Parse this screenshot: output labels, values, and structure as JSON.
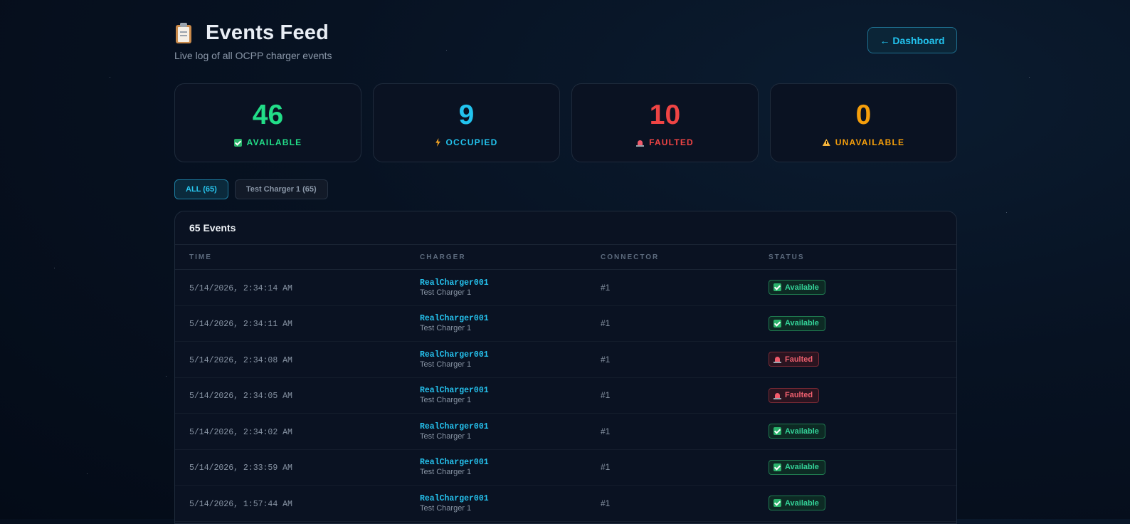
{
  "header": {
    "title": "Events Feed",
    "subtitle": "Live log of all OCPP charger events",
    "title_icon": "clipboard-icon",
    "dashboard_button": "← Dashboard"
  },
  "stats": [
    {
      "value": "46",
      "label": "AVAILABLE",
      "icon": "check-icon",
      "color": "#22dd88"
    },
    {
      "value": "9",
      "label": "OCCUPIED",
      "icon": "bolt-icon",
      "color": "#22c3ee"
    },
    {
      "value": "10",
      "label": "FAULTED",
      "icon": "siren-icon",
      "color": "#ef4444"
    },
    {
      "value": "0",
      "label": "UNAVAILABLE",
      "icon": "warning-icon",
      "color": "#f59e0b"
    }
  ],
  "filters": [
    {
      "label": "ALL (65)",
      "active": true
    },
    {
      "label": "Test Charger 1 (65)",
      "active": false
    }
  ],
  "table": {
    "title": "65 Events",
    "columns": [
      "TIME",
      "CHARGER",
      "CONNECTOR",
      "STATUS"
    ],
    "rows": [
      {
        "time": "5/14/2026, 2:34:14 AM",
        "charger_id": "RealCharger001",
        "charger_name": "Test Charger 1",
        "connector": "#1",
        "status": "Available"
      },
      {
        "time": "5/14/2026, 2:34:11 AM",
        "charger_id": "RealCharger001",
        "charger_name": "Test Charger 1",
        "connector": "#1",
        "status": "Available"
      },
      {
        "time": "5/14/2026, 2:34:08 AM",
        "charger_id": "RealCharger001",
        "charger_name": "Test Charger 1",
        "connector": "#1",
        "status": "Faulted"
      },
      {
        "time": "5/14/2026, 2:34:05 AM",
        "charger_id": "RealCharger001",
        "charger_name": "Test Charger 1",
        "connector": "#1",
        "status": "Faulted"
      },
      {
        "time": "5/14/2026, 2:34:02 AM",
        "charger_id": "RealCharger001",
        "charger_name": "Test Charger 1",
        "connector": "#1",
        "status": "Available"
      },
      {
        "time": "5/14/2026, 2:33:59 AM",
        "charger_id": "RealCharger001",
        "charger_name": "Test Charger 1",
        "connector": "#1",
        "status": "Available"
      },
      {
        "time": "5/14/2026, 1:57:44 AM",
        "charger_id": "RealCharger001",
        "charger_name": "Test Charger 1",
        "connector": "#1",
        "status": "Available"
      }
    ]
  },
  "colors": {
    "accent": "#22c3ee",
    "available": "#34d399",
    "faulted": "#f0606f"
  }
}
